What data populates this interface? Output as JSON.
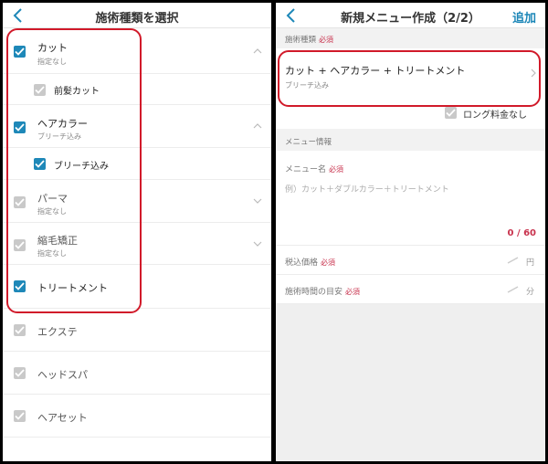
{
  "left": {
    "title": "施術種類を選択",
    "items": [
      {
        "label": "カット",
        "sub": "指定なし"
      },
      {
        "label": "前髪カット"
      },
      {
        "label": "ヘアカラー",
        "sub": "ブリーチ込み"
      },
      {
        "label": "ブリーチ込み"
      },
      {
        "label": "パーマ",
        "sub": "指定なし"
      },
      {
        "label": "縮毛矯正",
        "sub": "指定なし"
      },
      {
        "label": "トリートメント"
      },
      {
        "label": "エクステ"
      },
      {
        "label": "ヘッドスパ"
      },
      {
        "label": "ヘアセット"
      }
    ]
  },
  "right": {
    "title": "新規メニュー作成（2/2）",
    "action": "追加",
    "treatment_section_label": "施術種類",
    "required": "必須",
    "treatment_value": "カット + ヘアカラー + トリートメント",
    "treatment_sub": "ブリーチ込み",
    "long_fee_label": "ロング料金なし",
    "menu_info_label": "メニュー情報",
    "menu_name_label": "メニュー名",
    "menu_name_placeholder": "例）カット＋ダブルカラー＋トリートメント",
    "menu_name_counter": "0 / 60",
    "price_label": "税込価格",
    "price_unit": "円",
    "duration_label": "施術時間の目安",
    "duration_unit": "分"
  },
  "colors": {
    "accent": "#1e88b8",
    "required": "#c8324d",
    "highlight": "#d11a2a"
  }
}
